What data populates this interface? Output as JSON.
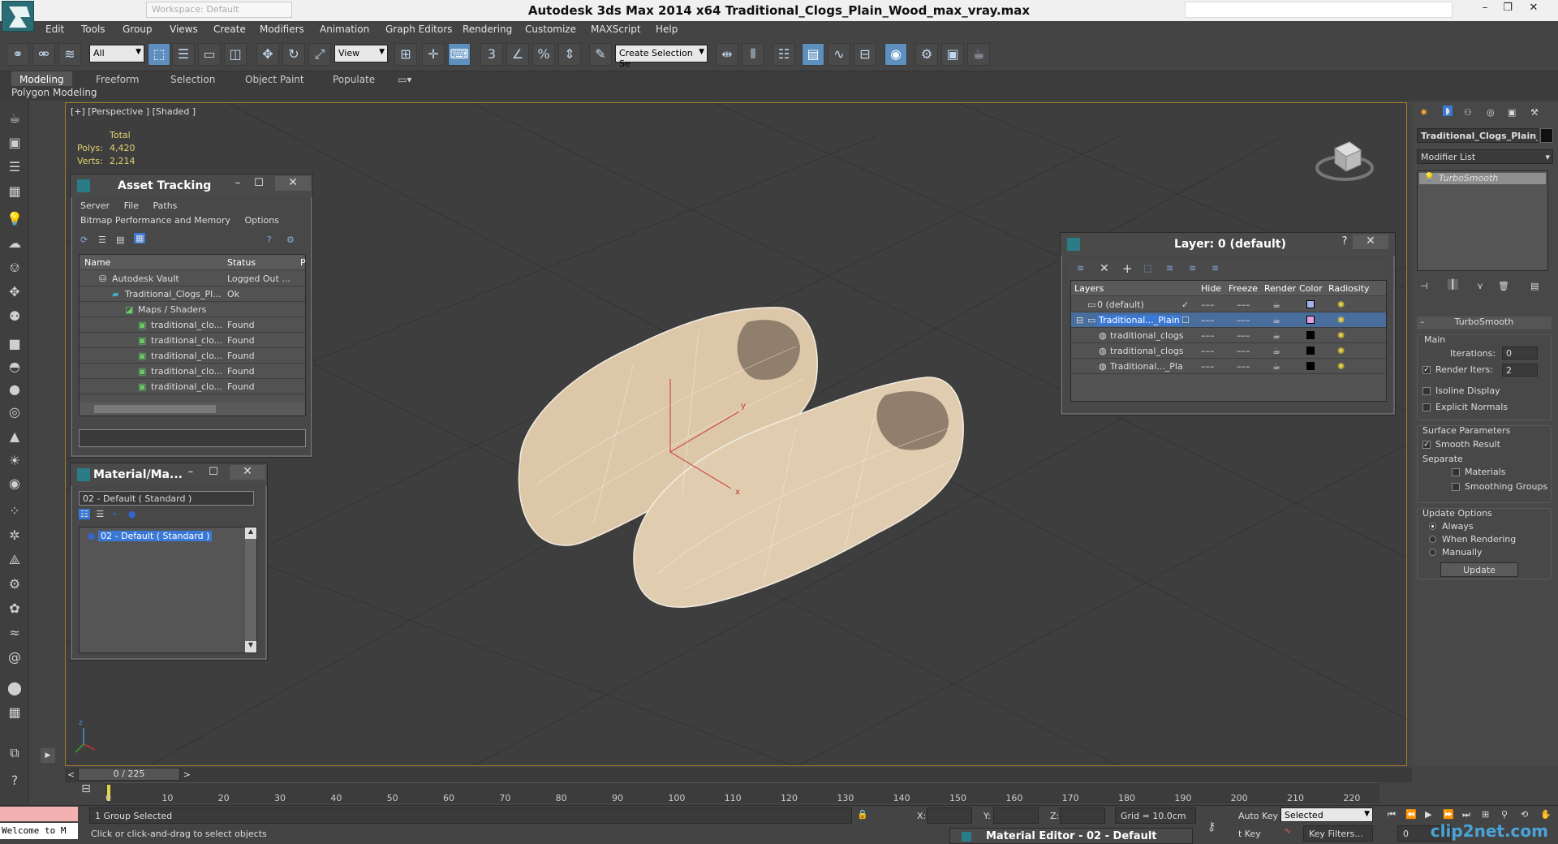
{
  "window": {
    "title": "Autodesk 3ds Max  2014 x64     Traditional_Clogs_Plain_Wood_max_vray.max",
    "workspace": "Workspace: Default"
  },
  "menu": [
    "Edit",
    "Tools",
    "Group",
    "Views",
    "Create",
    "Modifiers",
    "Animation",
    "Graph Editors",
    "Rendering",
    "Customize",
    "MAXScript",
    "Help"
  ],
  "toolbar": {
    "filter_value": "All",
    "refcoord_value": "View",
    "selection_set_placeholder": "Create Selection Se"
  },
  "ribbon": {
    "tabs": [
      "Modeling",
      "Freeform",
      "Selection",
      "Object Paint",
      "Populate"
    ],
    "sub_label": "Polygon Modeling"
  },
  "viewport": {
    "label": "[+] [Perspective ] [Shaded ]",
    "stats": {
      "header": "Total",
      "polys_label": "Polys:",
      "polys": "4,420",
      "verts_label": "Verts:",
      "verts": "2,214"
    },
    "axes": {
      "x": "x",
      "y": "y",
      "z": "z"
    }
  },
  "asset_tracking": {
    "title": "Asset Tracking",
    "menu": [
      "Server",
      "File",
      "Paths"
    ],
    "menu2": [
      "Bitmap Performance and Memory",
      "Options"
    ],
    "columns": [
      "Name",
      "Status",
      "P"
    ],
    "rows": [
      {
        "name": "Autodesk Vault",
        "status": "Logged Out ..."
      },
      {
        "name": "Traditional_Clogs_Pl...",
        "status": "Ok"
      },
      {
        "name": "Maps / Shaders",
        "status": ""
      },
      {
        "name": "traditional_clo...",
        "status": "Found"
      },
      {
        "name": "traditional_clo...",
        "status": "Found"
      },
      {
        "name": "traditional_clo...",
        "status": "Found"
      },
      {
        "name": "traditional_clo...",
        "status": "Found"
      },
      {
        "name": "traditional_clo...",
        "status": "Found"
      }
    ]
  },
  "material_panel": {
    "title": "Material/Ma...",
    "current": "02 - Default  ( Standard )",
    "item": "02 - Default  ( Standard )"
  },
  "layer_panel": {
    "title": "Layer: 0 (default)",
    "help": "?",
    "columns": [
      "Layers",
      "Hide",
      "Freeze",
      "Render",
      "Color",
      "Radiosity"
    ],
    "rows": [
      {
        "name": "0 (default)",
        "color": "#9fb3e6"
      },
      {
        "name": "Traditional..._Plain",
        "color": "#e0a0e0"
      },
      {
        "name": "traditional_clogs",
        "color": "#000000"
      },
      {
        "name": "traditional_clogs",
        "color": "#000000"
      },
      {
        "name": "Traditional..._Pla",
        "color": "#000000"
      }
    ]
  },
  "command_panel": {
    "object_name": "Traditional_Clogs_Plain_",
    "modifier_list": "Modifier List",
    "stack_item": "TurboSmooth",
    "rollout_title": "TurboSmooth",
    "main_label": "Main",
    "iterations_label": "Iterations:",
    "iterations": "0",
    "render_iters_label": "Render Iters:",
    "render_iters": "2",
    "isoline": "Isoline Display",
    "explicit": "Explicit Normals",
    "surface_params": "Surface Parameters",
    "smooth_result": "Smooth Result",
    "separate": "Separate",
    "materials": "Materials",
    "smoothing_groups": "Smoothing Groups",
    "update_options": "Update Options",
    "always": "Always",
    "when_rendering": "When Rendering",
    "manually": "Manually",
    "update_btn": "Update"
  },
  "timeline": {
    "slider": "0 / 225",
    "ticks": [
      "0",
      "10",
      "20",
      "30",
      "40",
      "50",
      "60",
      "70",
      "80",
      "90",
      "100",
      "110",
      "120",
      "130",
      "140",
      "150",
      "160",
      "170",
      "180",
      "190",
      "200",
      "210",
      "220"
    ]
  },
  "status": {
    "selection": "1 Group Selected",
    "prompt": "Click or click-and-drag to select objects",
    "x_label": "X:",
    "y_label": "Y:",
    "z_label": "Z:",
    "grid": "Grid = 10.0cm",
    "auto_key": "Auto Key",
    "set_key": "t Key",
    "selected": "Selected",
    "key_filters": "Key Filters...",
    "frame": "0",
    "maxscript": "Welcome to M",
    "material_editor": "Material Editor - 02 - Default",
    "watermark": "clip2net.com"
  },
  "colors": {
    "accent": "#5d8fbf",
    "viewport_border": "#a07f2a",
    "stats": "#e0d070",
    "selected_row": "#3a78d6"
  }
}
